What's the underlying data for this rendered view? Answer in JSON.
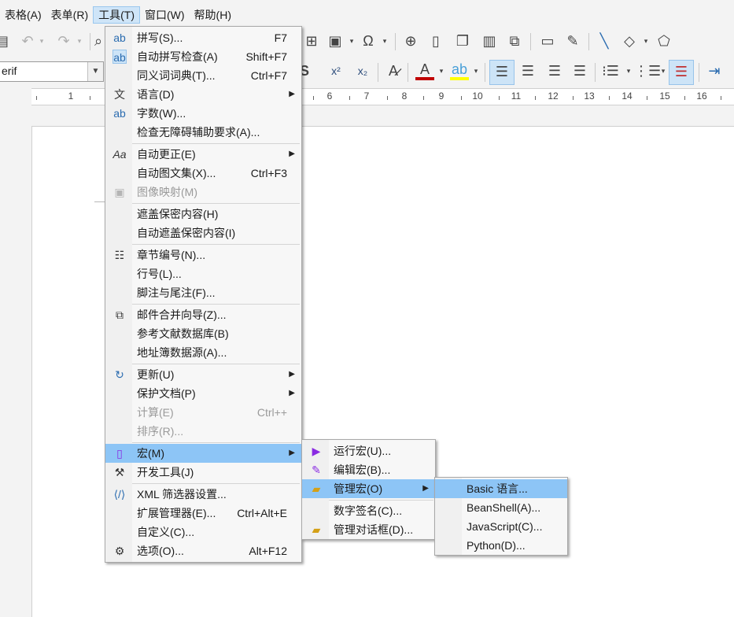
{
  "menubar": {
    "items": [
      {
        "label": "表格(A)",
        "active": false
      },
      {
        "label": "表单(R)",
        "active": false
      },
      {
        "label": "工具(T)",
        "active": true
      },
      {
        "label": "窗口(W)",
        "active": false
      },
      {
        "label": "帮助(H)",
        "active": false
      }
    ]
  },
  "toolbar": {
    "font_name_value": "erif",
    "superscript_label": "x²",
    "subscript_label": "x₂"
  },
  "ruler": {
    "numbers": [
      "1",
      "6",
      "7",
      "8",
      "9",
      "10",
      "11",
      "12",
      "13",
      "14",
      "15",
      "16"
    ]
  },
  "tools_menu": {
    "items": [
      {
        "label": "拼写(S)...",
        "shortcut": "F7",
        "icon": "spellcheck-icon"
      },
      {
        "label": "自动拼写检查(A)",
        "shortcut": "Shift+F7",
        "icon": "auto-spellcheck-icon"
      },
      {
        "label": "同义词词典(T)...",
        "shortcut": "Ctrl+F7"
      },
      {
        "label": "语言(D)",
        "submenu": true,
        "icon": "language-icon"
      },
      {
        "label": "字数(W)...",
        "icon": "word-count-icon"
      },
      {
        "label": "检查无障碍辅助要求(A)..."
      },
      {
        "label": "自动更正(E)",
        "submenu": true,
        "icon": "autocorrect-icon"
      },
      {
        "label": "自动图文集(X)...",
        "shortcut": "Ctrl+F3"
      },
      {
        "label": "图像映射(M)",
        "disabled": true,
        "icon": "image-map-icon"
      },
      {
        "label": "遮盖保密内容(H)"
      },
      {
        "label": "自动遮盖保密内容(I)"
      },
      {
        "label": "章节编号(N)...",
        "icon": "chapter-numbering-icon"
      },
      {
        "label": "行号(L)..."
      },
      {
        "label": "脚注与尾注(F)..."
      },
      {
        "label": "邮件合并向导(Z)...",
        "icon": "mail-merge-icon"
      },
      {
        "label": "参考文献数据库(B)"
      },
      {
        "label": "地址簿数据源(A)..."
      },
      {
        "label": "更新(U)",
        "submenu": true,
        "icon": "update-icon"
      },
      {
        "label": "保护文档(P)",
        "submenu": true
      },
      {
        "label": "计算(E)",
        "shortcut": "Ctrl++",
        "disabled": true
      },
      {
        "label": "排序(R)...",
        "disabled": true
      },
      {
        "label": "宏(M)",
        "submenu": true,
        "highlighted": true,
        "icon": "macro-icon"
      },
      {
        "label": "开发工具(J)",
        "icon": "development-tools-icon"
      },
      {
        "label": "XML 筛选器设置...",
        "icon": "xml-filter-icon"
      },
      {
        "label": "扩展管理器(E)...",
        "shortcut": "Ctrl+Alt+E"
      },
      {
        "label": "自定义(C)..."
      },
      {
        "label": "选项(O)...",
        "shortcut": "Alt+F12",
        "icon": "options-gear-icon"
      }
    ]
  },
  "macros_menu": {
    "items": [
      {
        "label": "运行宏(U)...",
        "icon": "run-macro-icon"
      },
      {
        "label": "编辑宏(B)...",
        "icon": "edit-macro-icon"
      },
      {
        "label": "管理宏(O)",
        "submenu": true,
        "highlighted": true,
        "icon": "organize-macros-icon"
      },
      {
        "label": "数字签名(C)..."
      },
      {
        "label": "管理对话框(D)...",
        "icon": "organize-dialogs-icon"
      }
    ]
  },
  "organize_macros_menu": {
    "items": [
      {
        "label": "Basic 语言...",
        "highlighted": true
      },
      {
        "label": "BeanShell(A)..."
      },
      {
        "label": "JavaScript(C)..."
      },
      {
        "label": "Python(D)..."
      }
    ]
  },
  "colors": {
    "menu_highlight": "#8dc5f6",
    "font_color_bar": "#c00000",
    "highlight_color_bar": "#ffff00"
  }
}
